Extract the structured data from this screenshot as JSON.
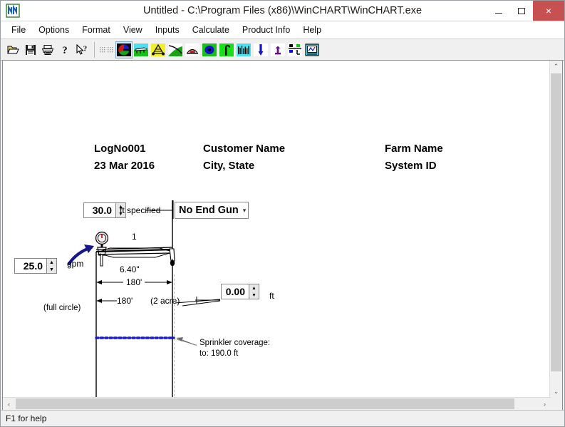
{
  "window": {
    "title": "Untitled - C:\\Program Files (x86)\\WinCHART\\WinCHART.exe",
    "app_icon": "winchart-logo-icon",
    "minimize_label": "",
    "maximize_label": "",
    "close_label": "×"
  },
  "menubar": {
    "items": [
      {
        "label": "File"
      },
      {
        "label": "Options"
      },
      {
        "label": "Format"
      },
      {
        "label": "View"
      },
      {
        "label": "Inputs"
      },
      {
        "label": "Calculate"
      },
      {
        "label": "Product Info"
      },
      {
        "label": "Help"
      }
    ]
  },
  "toolbar": {
    "file_group": [
      {
        "name": "open-icon"
      },
      {
        "name": "save-icon"
      },
      {
        "name": "print-icon"
      },
      {
        "name": "about-icon"
      },
      {
        "name": "context-help-icon"
      }
    ],
    "view_group": [
      {
        "name": "grid-icon",
        "selected": false
      },
      {
        "name": "plan-view-icon",
        "selected": true
      },
      {
        "name": "pipe-profile-icon",
        "selected": false
      },
      {
        "name": "tower-icon",
        "selected": false
      },
      {
        "name": "span-curve-icon",
        "selected": false
      },
      {
        "name": "end-gun-icon",
        "selected": false
      },
      {
        "name": "sprinkler-chart-icon",
        "selected": false
      },
      {
        "name": "drop-tube-icon",
        "selected": false
      },
      {
        "name": "pressure-profile-icon",
        "selected": false
      },
      {
        "name": "nozzle-icon",
        "selected": false
      },
      {
        "name": "regulator-icon",
        "selected": false
      },
      {
        "name": "summary-icon",
        "selected": false
      },
      {
        "name": "report-icon",
        "selected": false
      }
    ]
  },
  "drawing": {
    "header": {
      "log_no": "LogNo001",
      "date": "23 Mar 2016",
      "customer_name": "Customer Name",
      "city_state": "City, State",
      "farm_name": "Farm Name",
      "system_id": "System ID"
    },
    "pivot_height_input": {
      "name": "pivot-height-spinner",
      "value": "30.0",
      "unit_label": "ft specified"
    },
    "end_gun_select": {
      "name": "end-gun-dropdown",
      "value": "No End Gun",
      "options": [
        "No End Gun"
      ]
    },
    "flow_input": {
      "name": "flow-rate-spinner",
      "value": "25.0",
      "unit_label": "gpm"
    },
    "overhang_input": {
      "name": "overhang-spinner",
      "value": "0.00",
      "unit_label": "ft"
    },
    "span_number": "1",
    "pipe_diameter": "6.40\"",
    "span_length": "180'",
    "radius_length": "180'",
    "area_label": "(2 acre)",
    "rotation_label": "(full circle)",
    "coverage_note_line1": "Sprinkler coverage:",
    "coverage_note_line2": "to: 190.0 ft",
    "colors": {
      "sprinkler_line": "#1a1ac8",
      "flow_arrow": "#17178c",
      "gauge_needle": "#cc0000",
      "accent_selected": "#7aa8d0"
    }
  },
  "scrollbars": {
    "vertical": {
      "up_glyph": "⌃",
      "down_glyph": "⌄"
    },
    "horizontal": {
      "left_glyph": "‹",
      "right_glyph": "›"
    }
  },
  "statusbar": {
    "message": "F1 for help"
  }
}
